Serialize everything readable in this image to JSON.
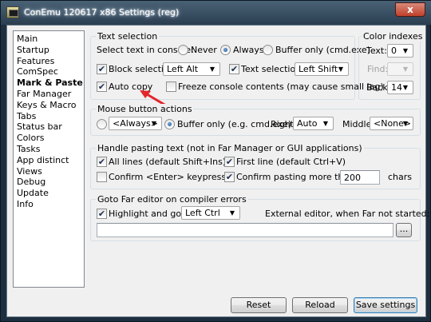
{
  "window": {
    "title": "ConEmu 120617 x86 Settings (reg)",
    "close_label": "x"
  },
  "nav": {
    "items": [
      {
        "label": "Main",
        "selected": false
      },
      {
        "label": "Startup",
        "selected": false
      },
      {
        "label": "Features",
        "selected": false
      },
      {
        "label": "ComSpec",
        "selected": false
      },
      {
        "label": "Mark & Paste",
        "selected": true
      },
      {
        "label": "Far Manager",
        "selected": false
      },
      {
        "label": "Keys & Macro",
        "selected": false
      },
      {
        "label": "Tabs",
        "selected": false
      },
      {
        "label": "Status bar",
        "selected": false
      },
      {
        "label": "Colors",
        "selected": false
      },
      {
        "label": "Tasks",
        "selected": false
      },
      {
        "label": "App distinct",
        "selected": false
      },
      {
        "label": "Views",
        "selected": false
      },
      {
        "label": "Debug",
        "selected": false
      },
      {
        "label": "Update",
        "selected": false
      },
      {
        "label": "Info",
        "selected": false
      }
    ]
  },
  "text_selection": {
    "title": "Text selection",
    "select_label": "Select text in console:",
    "radio_never": "Never",
    "radio_always": "Always",
    "radio_buffer": "Buffer only (cmd.exe)",
    "block_selection_label": "Block selection",
    "block_selection_key": "Left Alt",
    "text_selection_label": "Text selection",
    "text_selection_key": "Left Shift",
    "auto_copy_label": "Auto copy",
    "freeze_label": "Freeze console contents (may cause small lag)"
  },
  "color_indexes": {
    "title": "Color indexes",
    "text_label": "Text:",
    "text_value": "0",
    "find_label": "Find:",
    "find_value": "",
    "back_label": "Back:",
    "back_value": "14"
  },
  "mouse_actions": {
    "title": "Mouse button actions",
    "mode_value": "<Always>",
    "buffer_label": "Buffer only (e.g. cmd.exe)",
    "right_label": "Right:",
    "right_value": "Auto",
    "middle_label": "Middle:",
    "middle_value": "<None>"
  },
  "pasting": {
    "title": "Handle pasting text (not in Far Manager or GUI applications)",
    "all_lines_label": "All lines (default Shift+Ins)",
    "first_line_label": "First line (default Ctrl+V)",
    "confirm_enter_label": "Confirm <Enter> keypress",
    "confirm_more_label": "Confirm pasting more than",
    "chars_value": "200",
    "chars_label": "chars"
  },
  "goto_far": {
    "title": "Goto Far editor on compiler errors",
    "highlight_label": "Highlight and goto",
    "highlight_key": "Left Ctrl",
    "external_label": "External editor, when Far not started:",
    "editor_value": "",
    "browse_label": "..."
  },
  "footer": {
    "reset_label": "Reset",
    "reload_label": "Reload",
    "save_label": "Save settings"
  },
  "colors": {
    "frame": "#1d2f3e",
    "dialog_bg": "#f0f0f0",
    "arrow": "#e3262a"
  }
}
